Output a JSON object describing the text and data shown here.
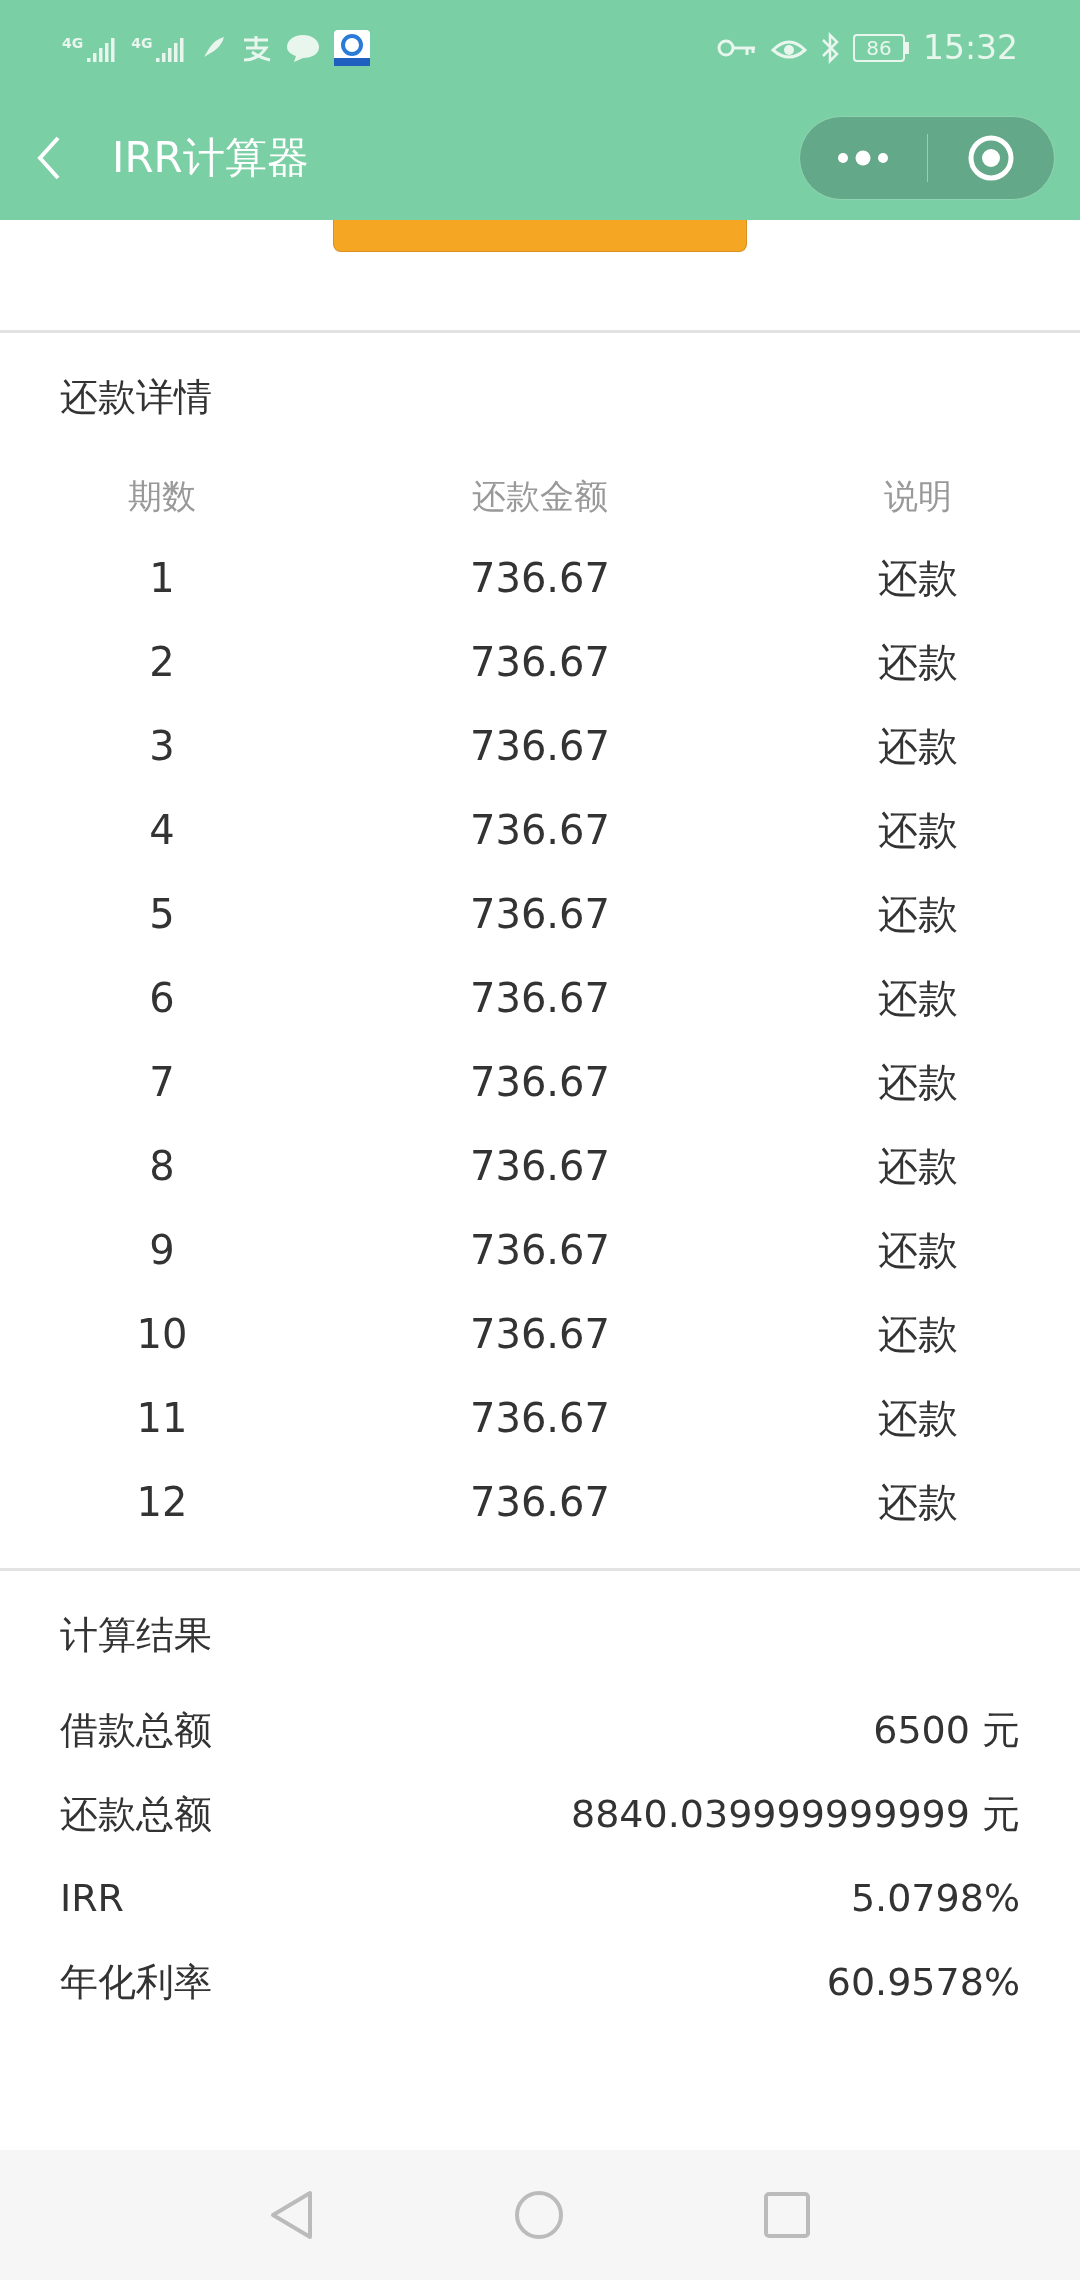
{
  "status_bar": {
    "networks": [
      "4G",
      "4G"
    ],
    "battery": "86",
    "time": "15:32"
  },
  "header": {
    "title": "IRR计算器"
  },
  "details": {
    "title": "还款详情",
    "columns": [
      "期数",
      "还款金额",
      "说明"
    ],
    "rows": [
      [
        "1",
        "736.67",
        "还款"
      ],
      [
        "2",
        "736.67",
        "还款"
      ],
      [
        "3",
        "736.67",
        "还款"
      ],
      [
        "4",
        "736.67",
        "还款"
      ],
      [
        "5",
        "736.67",
        "还款"
      ],
      [
        "6",
        "736.67",
        "还款"
      ],
      [
        "7",
        "736.67",
        "还款"
      ],
      [
        "8",
        "736.67",
        "还款"
      ],
      [
        "9",
        "736.67",
        "还款"
      ],
      [
        "10",
        "736.67",
        "还款"
      ],
      [
        "11",
        "736.67",
        "还款"
      ],
      [
        "12",
        "736.67",
        "还款"
      ]
    ]
  },
  "results": {
    "title": "计算结果",
    "rows": [
      {
        "label": "借款总额",
        "value": "6500 元"
      },
      {
        "label": "还款总额",
        "value": "8840.039999999999 元"
      },
      {
        "label": "IRR",
        "value": "5.0798%"
      },
      {
        "label": "年化利率",
        "value": "60.9578%"
      }
    ]
  }
}
